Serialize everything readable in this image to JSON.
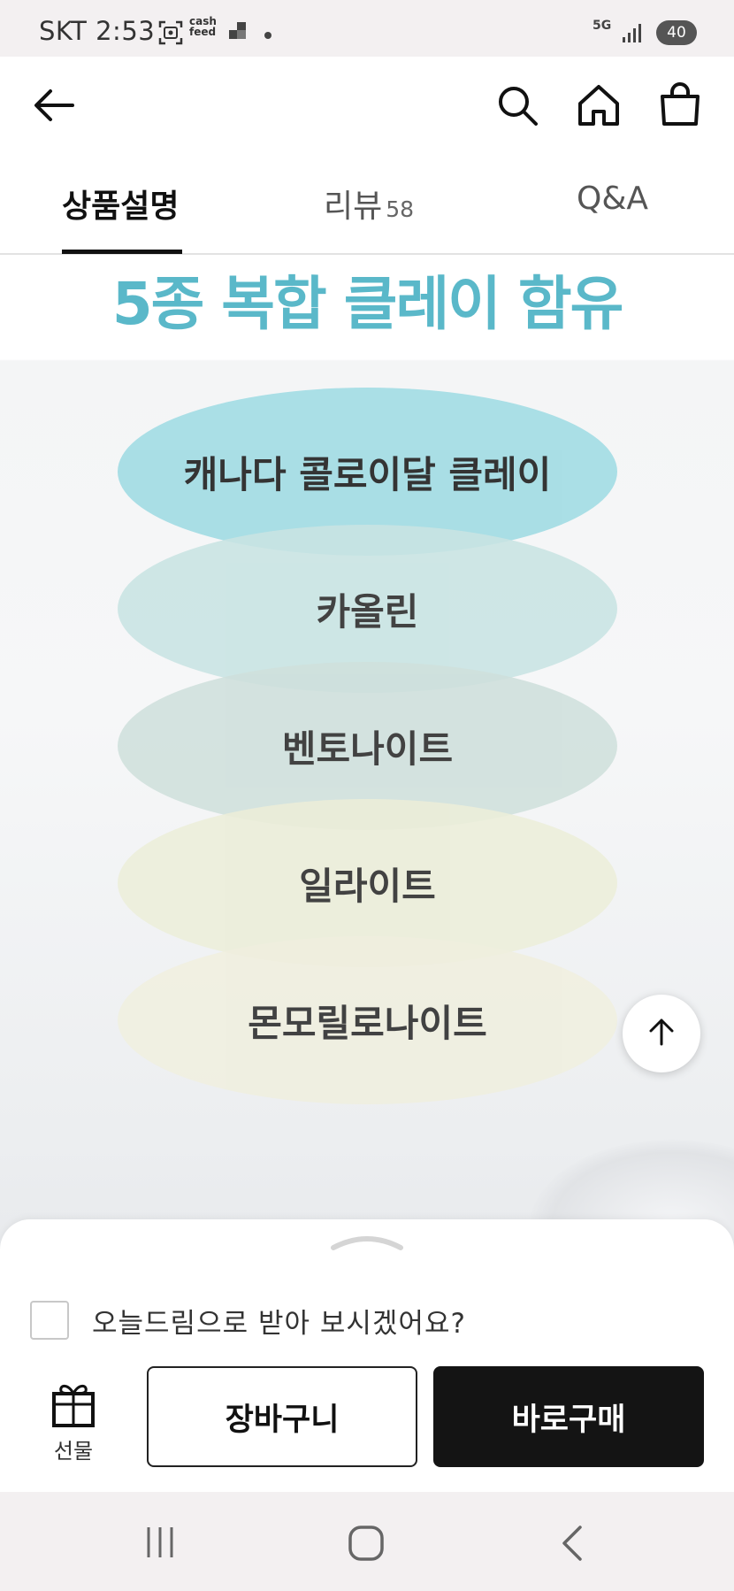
{
  "status_bar": {
    "time": "SKT 2:53",
    "notification_icons": [
      "screenshot-icon",
      "cashfeed-icon",
      "app-icon",
      "dot-icon"
    ],
    "cashfeed_text": "cash feed",
    "network": "5G",
    "battery": "40"
  },
  "top_nav": {
    "back_icon": "arrow-left-icon",
    "search_icon": "search-icon",
    "home_icon": "home-icon",
    "cart_icon": "shopping-bag-icon"
  },
  "tabs": [
    {
      "label": "상품설명",
      "active": true
    },
    {
      "label": "리뷰",
      "count": "58",
      "active": false
    },
    {
      "label": "Q&A",
      "active": false
    }
  ],
  "content": {
    "headline": "5종 복합 클레이 함유",
    "clays": [
      {
        "label": "캐나다 콜로이달 클레이",
        "color": "#a5dde5"
      },
      {
        "label": "카올린",
        "color": "#c8e4e3"
      },
      {
        "label": "벤토나이트",
        "color": "#cfe0dc"
      },
      {
        "label": "일라이트",
        "color": "#eceed9"
      },
      {
        "label": "몬모릴로나이트",
        "color": "#f0efdf"
      }
    ],
    "headline_color": "#5ab8c9"
  },
  "scroll_top_icon": "arrow-up-icon",
  "bottom_sheet": {
    "handle_icon": "chevron-up-icon",
    "delivery_option": "오늘드림으로 받아 보시겠어요?",
    "delivery_checked": false,
    "gift_label": "선물",
    "gift_icon": "gift-icon",
    "cart_button": "장바구니",
    "buy_button": "바로구매"
  },
  "android_nav": {
    "recents_icon": "recents-icon",
    "home_icon": "home-circle-icon",
    "back_icon": "back-chevron-icon"
  }
}
